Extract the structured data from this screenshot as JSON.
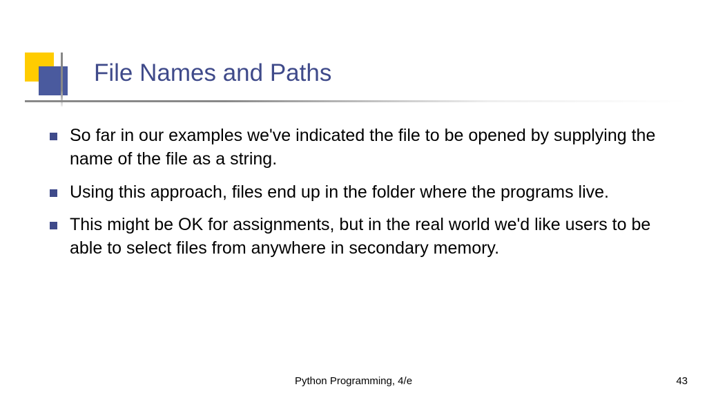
{
  "slide": {
    "title": "File Names and Paths",
    "bullets": [
      "So far in our examples we've indicated the file to be opened by supplying the name of the file as a string.",
      "Using this approach, files end up in the folder where the programs live.",
      "This might be OK for assignments, but in the real world we'd like users to be able to select files from anywhere in secondary memory."
    ],
    "footer": "Python Programming, 4/e",
    "pageNumber": "43"
  }
}
